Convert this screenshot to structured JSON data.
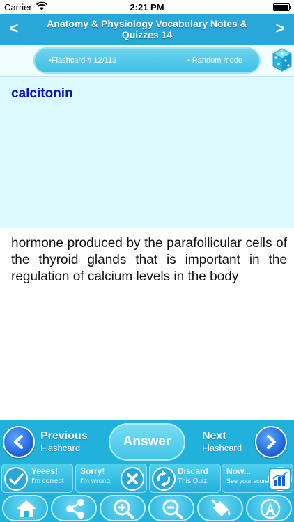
{
  "status_bar": {
    "carrier": "Carrier",
    "time": "2:21 PM"
  },
  "header": {
    "title": "Anatomy & Physiology Vocabulary Notes & Quizzes 14",
    "prev_glyph": "<",
    "next_glyph": ">"
  },
  "info": {
    "counter": "•Flashcard #  12/113",
    "mode": "• Random mode"
  },
  "card": {
    "term": "calcitonin",
    "definition": "hormone produced by the parafollicular cells of the thyroid glands that is important in the regulation of calcium levels in the body"
  },
  "nav": {
    "previous": {
      "big": "Previous",
      "small": "Flashcard"
    },
    "answer": "Answer",
    "next": {
      "big": "Next",
      "small": "Flashcard"
    }
  },
  "actions": [
    {
      "title": "Yeees!",
      "subtitle": "I'm correct",
      "icon": "check-icon"
    },
    {
      "title": "Sorry!",
      "subtitle": "I'm wrong",
      "icon": "x-icon"
    },
    {
      "title": "Discard",
      "subtitle": "This Quiz",
      "icon": "recycle-icon"
    },
    {
      "title": "Now...",
      "subtitle": "See your score",
      "icon": "chart-icon"
    }
  ],
  "toolbar": [
    "home-icon",
    "share-icon",
    "zoom-in-icon",
    "zoom-out-icon",
    "paint-bucket-icon",
    "font-icon"
  ],
  "colors": {
    "header": "#2aa7d9",
    "panel": "#21b2dc",
    "term_text": "#1010c8",
    "term_background": "#ddfbff",
    "nav_circle": "#1a5fd6"
  }
}
